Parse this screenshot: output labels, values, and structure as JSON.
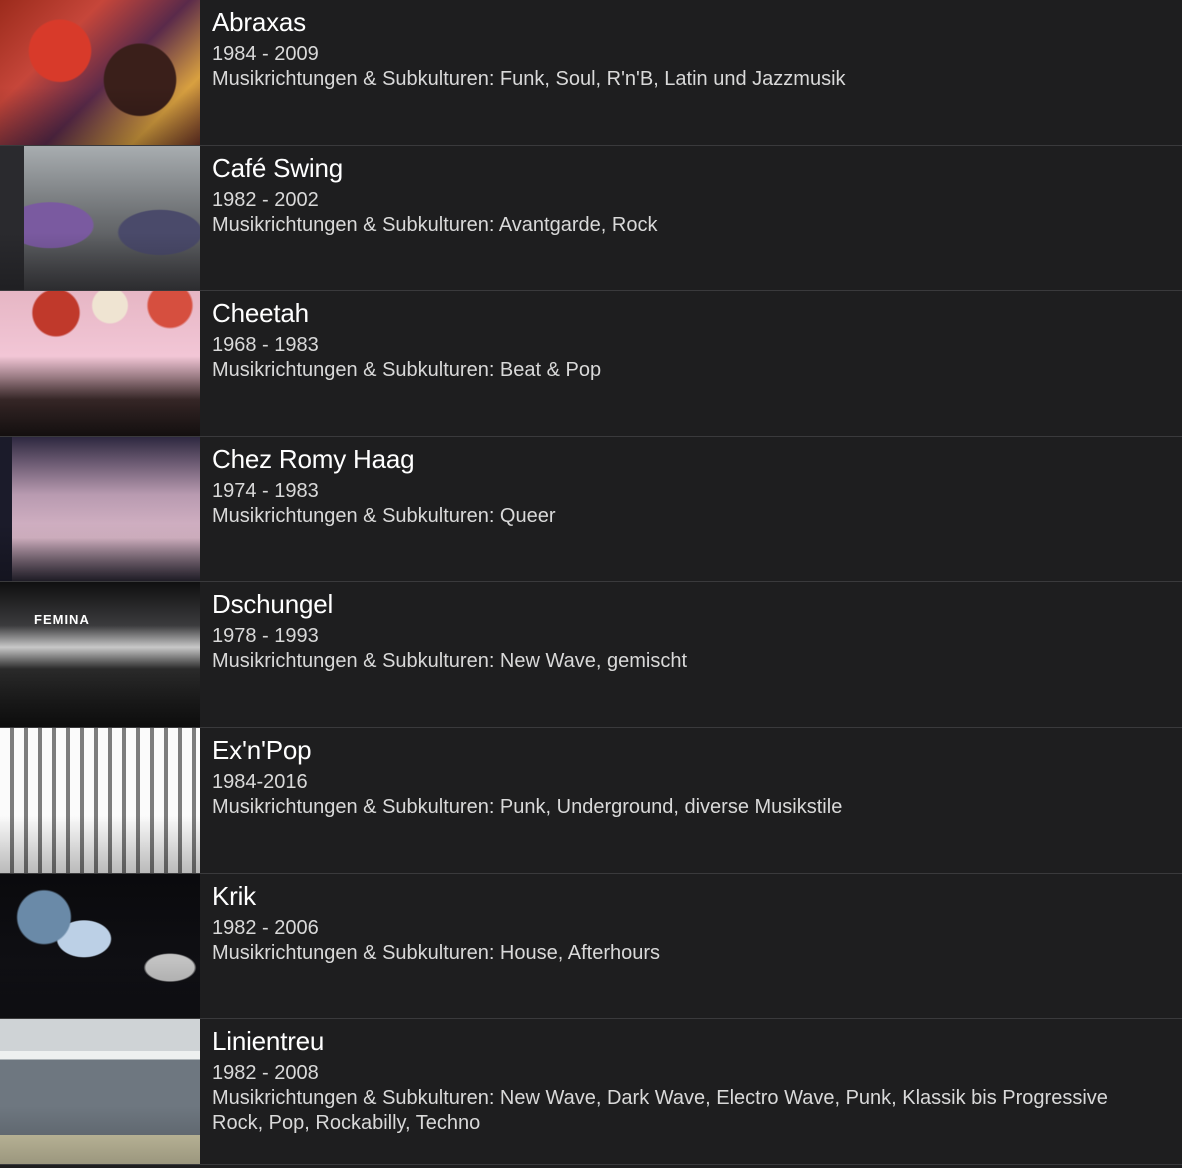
{
  "list": [
    {
      "title": "Abraxas",
      "years": "1984 - 2009",
      "genres": "Musikrichtungen & Subkulturen: Funk, Soul, R'n'B, Latin und Jazzmusik",
      "thumb_icon": "album-cover-image"
    },
    {
      "title": "Café Swing",
      "years": "1982 - 2002",
      "genres": "Musikrichtungen & Subkulturen: Avantgarde, Rock",
      "thumb_icon": "club-photo-image"
    },
    {
      "title": "Cheetah",
      "years": "1968 - 1983",
      "genres": "Musikrichtungen & Subkulturen: Beat & Pop",
      "thumb_icon": "club-photo-image"
    },
    {
      "title": "Chez Romy Haag",
      "years": "1974 - 1983",
      "genres": "Musikrichtungen & Subkulturen: Queer",
      "thumb_icon": "club-photo-image"
    },
    {
      "title": "Dschungel",
      "years": "1978 - 1993",
      "genres": "Musikrichtungen & Subkulturen: New Wave, gemischt",
      "thumb_icon": "club-photo-image",
      "sign_text": "FEMINA"
    },
    {
      "title": "Ex'n'Pop",
      "years": "1984-2016",
      "genres": "Musikrichtungen & Subkulturen: Punk, Underground, diverse Musikstile",
      "thumb_icon": "club-photo-image"
    },
    {
      "title": "Krik",
      "years": "1982 - 2006",
      "genres": "Musikrichtungen & Subkulturen: House, Afterhours",
      "thumb_icon": "club-photo-image"
    },
    {
      "title": "Linientreu",
      "years": "1982 - 2008",
      "genres": "Musikrichtungen & Subkulturen: New Wave, Dark Wave, Electro Wave, Punk, Klassik bis Progressive Rock, Pop, Rockabilly, Techno",
      "thumb_icon": "club-photo-image"
    }
  ],
  "colors": {
    "background": "#1e1e1f",
    "divider": "#3a3a3c",
    "title": "#ffffff",
    "text": "#d9d9d9"
  }
}
